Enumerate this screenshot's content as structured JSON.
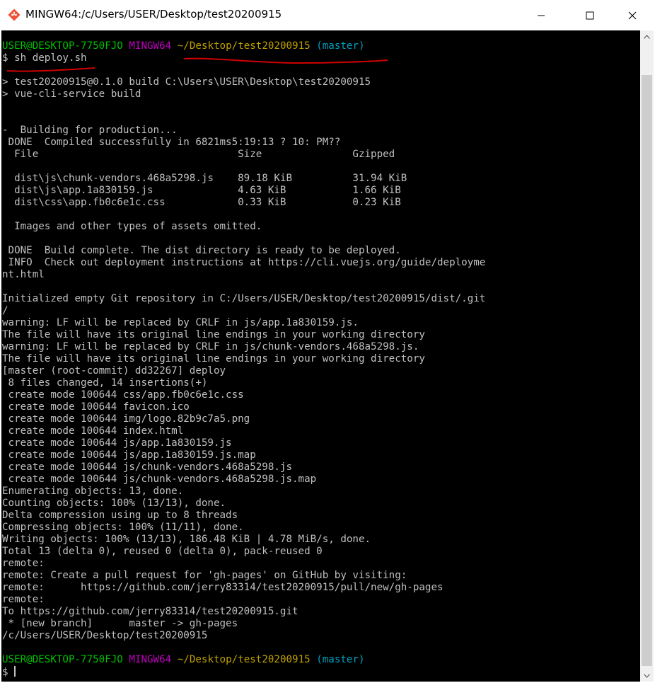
{
  "window": {
    "title": "MINGW64:/c/Users/USER/Desktop/test20200915",
    "minimize_symbol": "—",
    "maximize_symbol": "☐",
    "close_symbol": "✕"
  },
  "colors": {
    "prompt_user": "#00c000",
    "prompt_env": "#c000c0",
    "prompt_path": "#c0a000",
    "prompt_branch": "#00a0c0",
    "output_text": "#c0c0c0",
    "annotation": "#d00000"
  },
  "prompt": {
    "user_host": "USER@DESKTOP-7750FJO",
    "env": "MINGW64",
    "path": "~/Desktop/test20200915",
    "branch": "(master)",
    "symbol": "$"
  },
  "command": "sh deploy.sh",
  "output": [
    "",
    "> test20200915@0.1.0 build C:\\Users\\USER\\Desktop\\test20200915",
    "> vue-cli-service build",
    "",
    "",
    "-  Building for production...",
    " DONE  Compiled successfully in 6821ms5:19:13 ? 10: PM??",
    "  File                                 Size               Gzipped",
    "",
    "  dist\\js\\chunk-vendors.468a5298.js    89.18 KiB          31.94 KiB",
    "  dist\\js\\app.1a830159.js              4.63 KiB           1.66 KiB",
    "  dist\\css\\app.fb0c6e1c.css            0.33 KiB           0.23 KiB",
    "",
    "  Images and other types of assets omitted.",
    "",
    " DONE  Build complete. The dist directory is ready to be deployed.",
    " INFO  Check out deployment instructions at https://cli.vuejs.org/guide/deployme",
    "nt.html",
    "",
    "Initialized empty Git repository in C:/Users/USER/Desktop/test20200915/dist/.git",
    "/",
    "warning: LF will be replaced by CRLF in js/app.1a830159.js.",
    "The file will have its original line endings in your working directory",
    "warning: LF will be replaced by CRLF in js/chunk-vendors.468a5298.js.",
    "The file will have its original line endings in your working directory",
    "[master (root-commit) dd32267] deploy",
    " 8 files changed, 14 insertions(+)",
    " create mode 100644 css/app.fb0c6e1c.css",
    " create mode 100644 favicon.ico",
    " create mode 100644 img/logo.82b9c7a5.png",
    " create mode 100644 index.html",
    " create mode 100644 js/app.1a830159.js",
    " create mode 100644 js/app.1a830159.js.map",
    " create mode 100644 js/chunk-vendors.468a5298.js",
    " create mode 100644 js/chunk-vendors.468a5298.js.map",
    "Enumerating objects: 13, done.",
    "Counting objects: 100% (13/13), done.",
    "Delta compression using up to 8 threads",
    "Compressing objects: 100% (11/11), done.",
    "Writing objects: 100% (13/13), 186.48 KiB | 4.78 MiB/s, done.",
    "Total 13 (delta 0), reused 0 (delta 0), pack-reused 0",
    "remote:",
    "remote: Create a pull request for 'gh-pages' on GitHub by visiting:",
    "remote:      https://github.com/jerry83314/test20200915/pull/new/gh-pages",
    "remote:",
    "To https://github.com/jerry83314/test20200915.git",
    " * [new branch]      master -> gh-pages",
    "/c/Users/USER/Desktop/test20200915",
    ""
  ]
}
